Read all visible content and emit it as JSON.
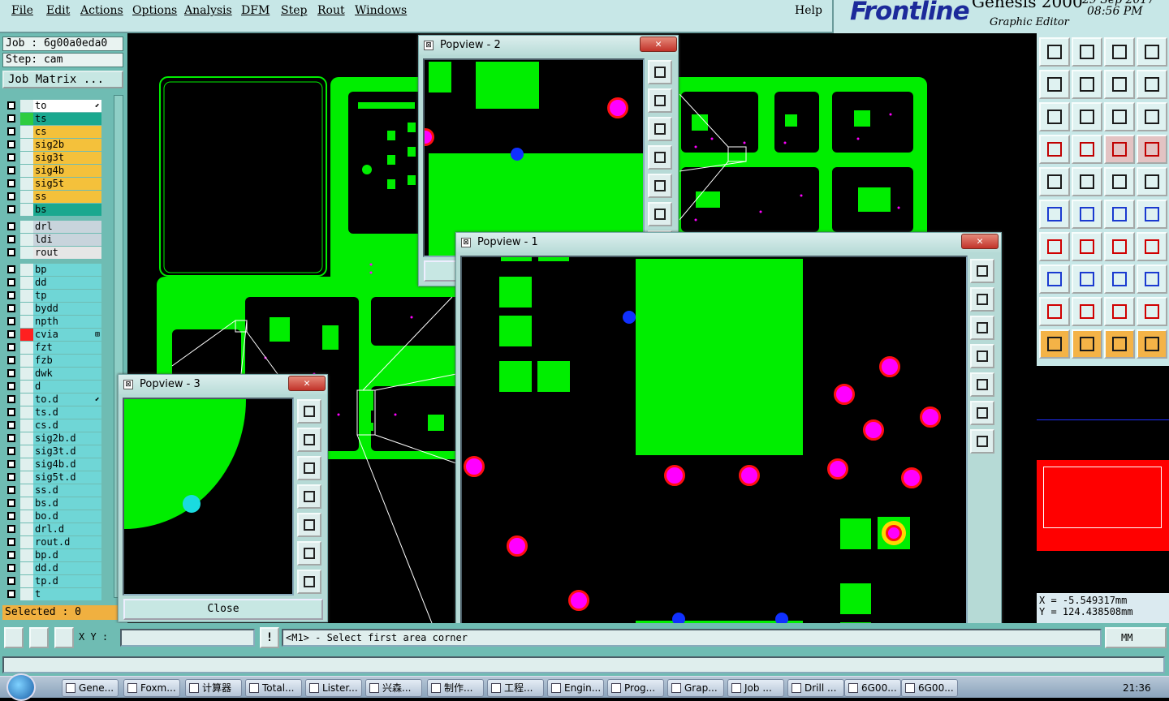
{
  "menu": [
    "File",
    "Edit",
    "Actions",
    "Options",
    "Analysis",
    "DFM",
    "Step",
    "Rout",
    "Windows"
  ],
  "help_label": "Help",
  "logo": {
    "brand": "Frontline",
    "product": "Genesis 2000",
    "subtitle": "Graphic Editor",
    "date": "29 Sep 2017",
    "time": "08:56 PM"
  },
  "job": {
    "job_label": "Job : 6g00a0eda0",
    "step_label": "Step: cam",
    "matrix_button": "Job Matrix ..."
  },
  "layers": [
    {
      "name": "to",
      "color": "#ffffff",
      "state": "#e0f0ee",
      "mark": "⬋"
    },
    {
      "name": "ts",
      "color": "#1aa88f",
      "state": "#2ecc40",
      "mark": ""
    },
    {
      "name": "cs",
      "color": "#f4c13b",
      "state": "#e0f0ee",
      "mark": ""
    },
    {
      "name": "sig2b",
      "color": "#f4c13b",
      "state": "#e0f0ee",
      "mark": ""
    },
    {
      "name": "sig3t",
      "color": "#f4c13b",
      "state": "#e0f0ee",
      "mark": ""
    },
    {
      "name": "sig4b",
      "color": "#f4c13b",
      "state": "#e0f0ee",
      "mark": ""
    },
    {
      "name": "sig5t",
      "color": "#f4c13b",
      "state": "#e0f0ee",
      "mark": ""
    },
    {
      "name": "ss",
      "color": "#f4c13b",
      "state": "#e0f0ee",
      "mark": ""
    },
    {
      "name": "bs",
      "color": "#1aa88f",
      "state": "#e0f0ee",
      "mark": ""
    },
    {
      "name": "drl",
      "color": "#c8d4dc",
      "state": "#e0f0ee",
      "mark": ""
    },
    {
      "name": "ldi",
      "color": "#c8d4dc",
      "state": "#e0f0ee",
      "mark": ""
    },
    {
      "name": "rout",
      "color": "#e6e6e6",
      "state": "#e0f0ee",
      "mark": ""
    },
    {
      "name": "bp",
      "color": "#6fd6d6",
      "state": "#e0f0ee",
      "mark": ""
    },
    {
      "name": "dd",
      "color": "#6fd6d6",
      "state": "#e0f0ee",
      "mark": ""
    },
    {
      "name": "tp",
      "color": "#6fd6d6",
      "state": "#e0f0ee",
      "mark": ""
    },
    {
      "name": "bydd",
      "color": "#6fd6d6",
      "state": "#e0f0ee",
      "mark": ""
    },
    {
      "name": "npth",
      "color": "#6fd6d6",
      "state": "#e0f0ee",
      "mark": ""
    },
    {
      "name": "cvia",
      "color": "#6fd6d6",
      "state": "#ff2020",
      "mark": "⊞"
    },
    {
      "name": "fzt",
      "color": "#6fd6d6",
      "state": "#e0f0ee",
      "mark": ""
    },
    {
      "name": "fzb",
      "color": "#6fd6d6",
      "state": "#e0f0ee",
      "mark": ""
    },
    {
      "name": "dwk",
      "color": "#6fd6d6",
      "state": "#e0f0ee",
      "mark": ""
    },
    {
      "name": "d",
      "color": "#6fd6d6",
      "state": "#e0f0ee",
      "mark": ""
    },
    {
      "name": "to.d",
      "color": "#6fd6d6",
      "state": "#e0f0ee",
      "mark": "⬋"
    },
    {
      "name": "ts.d",
      "color": "#6fd6d6",
      "state": "#e0f0ee",
      "mark": ""
    },
    {
      "name": "cs.d",
      "color": "#6fd6d6",
      "state": "#e0f0ee",
      "mark": ""
    },
    {
      "name": "sig2b.d",
      "color": "#6fd6d6",
      "state": "#e0f0ee",
      "mark": ""
    },
    {
      "name": "sig3t.d",
      "color": "#6fd6d6",
      "state": "#e0f0ee",
      "mark": ""
    },
    {
      "name": "sig4b.d",
      "color": "#6fd6d6",
      "state": "#e0f0ee",
      "mark": ""
    },
    {
      "name": "sig5t.d",
      "color": "#6fd6d6",
      "state": "#e0f0ee",
      "mark": ""
    },
    {
      "name": "ss.d",
      "color": "#6fd6d6",
      "state": "#e0f0ee",
      "mark": ""
    },
    {
      "name": "bs.d",
      "color": "#6fd6d6",
      "state": "#e0f0ee",
      "mark": ""
    },
    {
      "name": "bo.d",
      "color": "#6fd6d6",
      "state": "#e0f0ee",
      "mark": ""
    },
    {
      "name": "drl.d",
      "color": "#6fd6d6",
      "state": "#e0f0ee",
      "mark": ""
    },
    {
      "name": "rout.d",
      "color": "#6fd6d6",
      "state": "#e0f0ee",
      "mark": ""
    },
    {
      "name": "bp.d",
      "color": "#6fd6d6",
      "state": "#e0f0ee",
      "mark": ""
    },
    {
      "name": "dd.d",
      "color": "#6fd6d6",
      "state": "#e0f0ee",
      "mark": ""
    },
    {
      "name": "tp.d",
      "color": "#6fd6d6",
      "state": "#e0f0ee",
      "mark": ""
    },
    {
      "name": "t",
      "color": "#6fd6d6",
      "state": "#e0f0ee",
      "mark": ""
    }
  ],
  "selected_label": "Selected : 0",
  "popviews": {
    "p1": "Popview - 1",
    "p2": "Popview - 2",
    "p3": "Popview - 3",
    "close_glyph": "✕",
    "close_button": "Close"
  },
  "coords": {
    "x": "X = -5.549317mm",
    "y": "Y = 124.438508mm"
  },
  "command": {
    "xy_label": "X Y :",
    "xy_value": "",
    "message": "<M1> - Select first area corner",
    "units": "MM"
  },
  "taskbar": {
    "items": [
      "Gene...",
      "Foxm...",
      "计算器",
      "Total...",
      "Lister...",
      "兴森...",
      "制作...",
      "工程...",
      "Engin...",
      "Prog...",
      "Grap...",
      "Job ...",
      "Drill ...",
      "6G00...",
      "6G00..."
    ],
    "clock": "21:36"
  },
  "colors": {
    "copper": "#00ee00",
    "via_ring": "#ff1010",
    "via_fill": "#ff00ff",
    "blind_via": "#1030ff",
    "panel": "#6fbcb3",
    "menubar": "#c7e7e7",
    "brand": "#1c2a9a"
  }
}
